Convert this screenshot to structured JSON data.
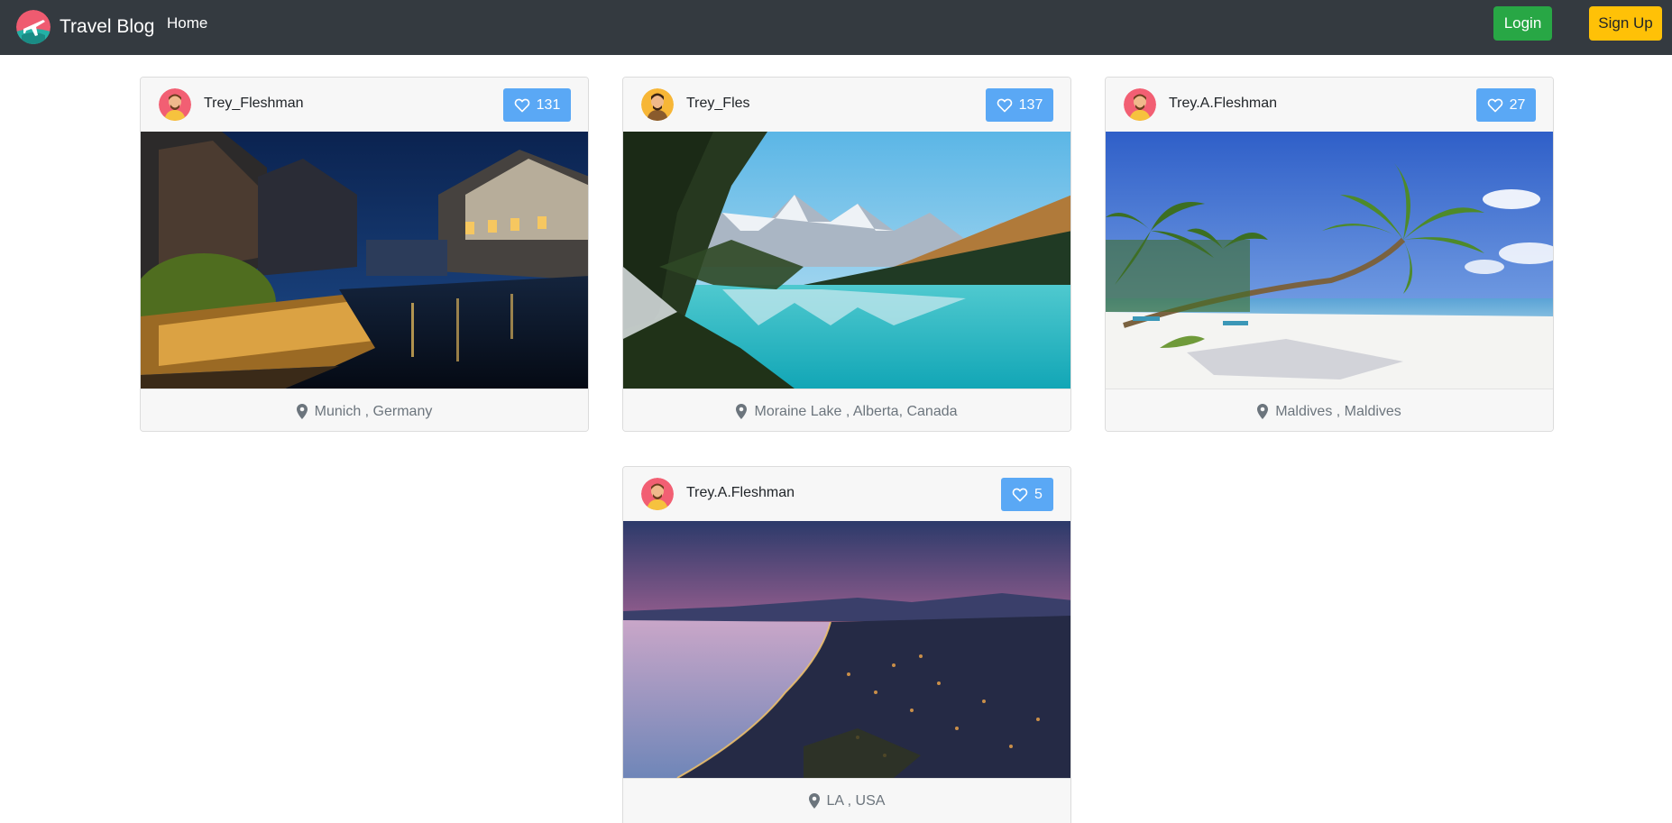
{
  "nav": {
    "brand": "Travel Blog",
    "home": "Home",
    "login": "Login",
    "signup": "Sign Up"
  },
  "posts": [
    {
      "user": "Trey_Fleshman",
      "likes": "131",
      "location": "Munich , Germany"
    },
    {
      "user": "Trey_Fles",
      "likes": "137",
      "location": "Moraine Lake , Alberta, Canada"
    },
    {
      "user": "Trey.A.Fleshman",
      "likes": "27",
      "location": "Maldives , Maldives"
    },
    {
      "user": "Trey.A.Fleshman",
      "likes": "5",
      "location": "LA , USA"
    }
  ],
  "icons": {
    "brand": "plane-globe-logo-icon",
    "like": "heart-icon",
    "location": "map-marker-icon",
    "avatar": "avatar-icon"
  },
  "colors": {
    "navbar": "#343a40",
    "login": "#28a745",
    "signup": "#ffc107",
    "like": "#5aa8f5"
  }
}
